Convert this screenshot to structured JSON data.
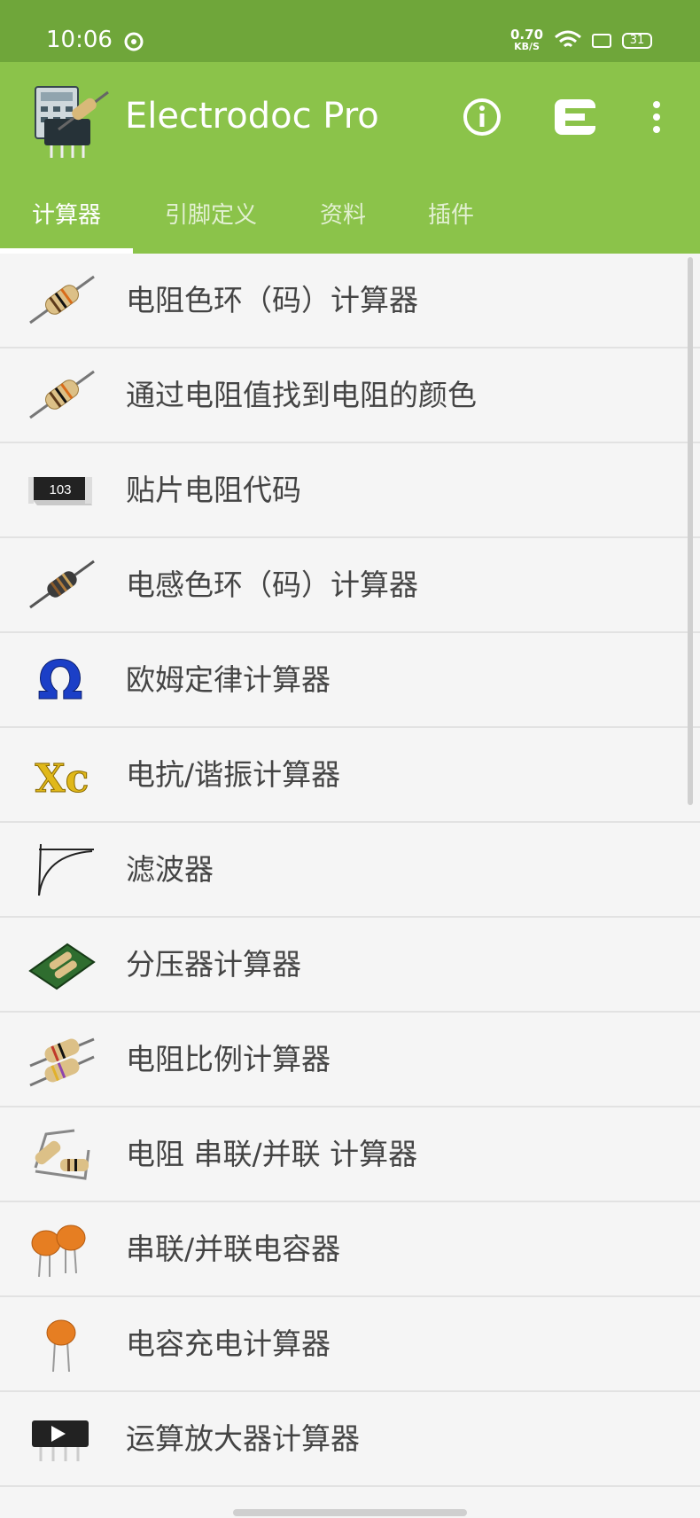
{
  "status_bar": {
    "time": "10:06",
    "network_speed_value": "0.70",
    "network_speed_unit": "KB/S",
    "battery": "31"
  },
  "app_bar": {
    "title": "Electrodoc Pro",
    "tabs": [
      {
        "label": "计算器",
        "active": true
      },
      {
        "label": "引脚定义",
        "active": false
      },
      {
        "label": "资料",
        "active": false
      },
      {
        "label": "插件",
        "active": false
      }
    ]
  },
  "list": {
    "items": [
      {
        "label": "电阻色环（码）计算器",
        "icon": "resistor-icon"
      },
      {
        "label": "通过电阻值找到电阻的颜色",
        "icon": "resistor-icon"
      },
      {
        "label": "贴片电阻代码",
        "icon": "smd-resistor-icon",
        "icon_text": "103"
      },
      {
        "label": "电感色环（码）计算器",
        "icon": "inductor-icon"
      },
      {
        "label": "欧姆定律计算器",
        "icon": "ohm-icon",
        "icon_text": "Ω"
      },
      {
        "label": "电抗/谐振计算器",
        "icon": "reactance-icon",
        "icon_text": "Xc"
      },
      {
        "label": "滤波器",
        "icon": "filter-curve-icon"
      },
      {
        "label": "分压器计算器",
        "icon": "voltage-divider-board-icon"
      },
      {
        "label": "电阻比例计算器",
        "icon": "resistor-pair-icon"
      },
      {
        "label": "电阻 串联/并联 计算器",
        "icon": "resistor-network-icon"
      },
      {
        "label": "串联/并联电容器",
        "icon": "capacitor-pair-icon"
      },
      {
        "label": "电容充电计算器",
        "icon": "capacitor-icon"
      },
      {
        "label": "运算放大器计算器",
        "icon": "opamp-chip-icon"
      }
    ]
  },
  "colors": {
    "status_bar": "#6fa63a",
    "app_bar": "#8bc34a",
    "list_background": "#f5f5f5"
  }
}
